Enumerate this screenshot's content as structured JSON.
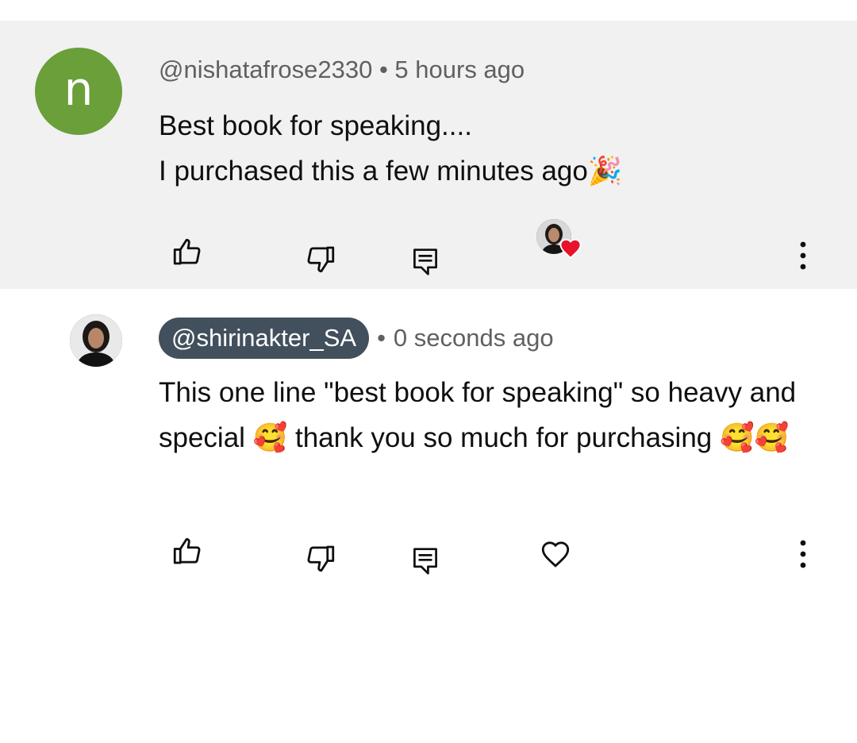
{
  "comments": [
    {
      "avatar_letter": "n",
      "avatar_color": "#6a9f3a",
      "author": "@nishatafrose2330",
      "separator": "•",
      "time": "5 hours ago",
      "lines": [
        "Best book for speaking....",
        "I purchased this a few minutes ago🎉"
      ]
    },
    {
      "author": "@shirinakter_SA",
      "separator": "•",
      "time": "0 seconds ago",
      "text": "This one line \"best book for speaking\" so heavy and special 🥰 thank you so much for purchasing 🥰🥰"
    }
  ],
  "colors": {
    "highlight_background": "#f1f1f1",
    "creator_chip": "#41505c",
    "heart_red": "#e8132b"
  },
  "icons": [
    "thumbs-up-icon",
    "thumbs-down-icon",
    "reply-icon",
    "creator-heart-icon",
    "heart-outline-icon",
    "more-vertical-icon"
  ]
}
